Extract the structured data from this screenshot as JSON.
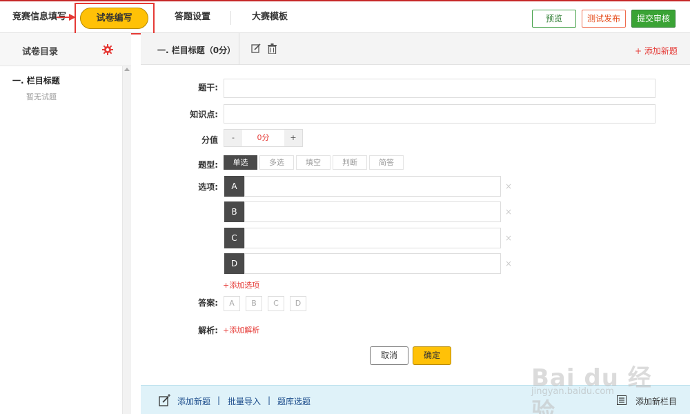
{
  "topnav": {
    "info_label": "竞赛信息填写",
    "active_label": "试卷编写",
    "answer_label": "答题设置",
    "template_label": "大赛模板",
    "preview_label": "预览",
    "test_publish_label": "测试发布",
    "submit_label": "提交审核"
  },
  "sidebar": {
    "title": "试卷目录",
    "section": "一. 栏目标题",
    "empty": "暂无试题"
  },
  "section": {
    "title": "一.  栏目标题（0分）",
    "add_question": "+ 添加新题"
  },
  "form": {
    "stem_label": "题干:",
    "knowledge_label": "知识点:",
    "score_label": "分值",
    "score_minus": "-",
    "score_value": "0分",
    "score_plus": "+",
    "type_label": "题型:",
    "types": [
      "单选",
      "多选",
      "填空",
      "判断",
      "简答"
    ],
    "active_type": "单选",
    "options_label": "选项:",
    "options": [
      "A",
      "B",
      "C",
      "D"
    ],
    "option_delete": "×",
    "add_option": "+添加选项",
    "answer_label": "答案:",
    "answers": [
      "A",
      "B",
      "C",
      "D"
    ],
    "analysis_label": "解析:",
    "add_analysis": "+添加解析",
    "cancel": "取消",
    "confirm": "确定"
  },
  "bottombar": {
    "add_question": "添加新题",
    "sep": "|",
    "batch_import": "批量导入",
    "bank_select": "题库选题",
    "add_column": "添加新栏目"
  },
  "watermark": {
    "text": "Bai du 经验",
    "sub": "jingyan.baidu.com"
  },
  "colors": {
    "accent": "#ffc107",
    "green": "#3aa335",
    "red": "#e53935"
  }
}
